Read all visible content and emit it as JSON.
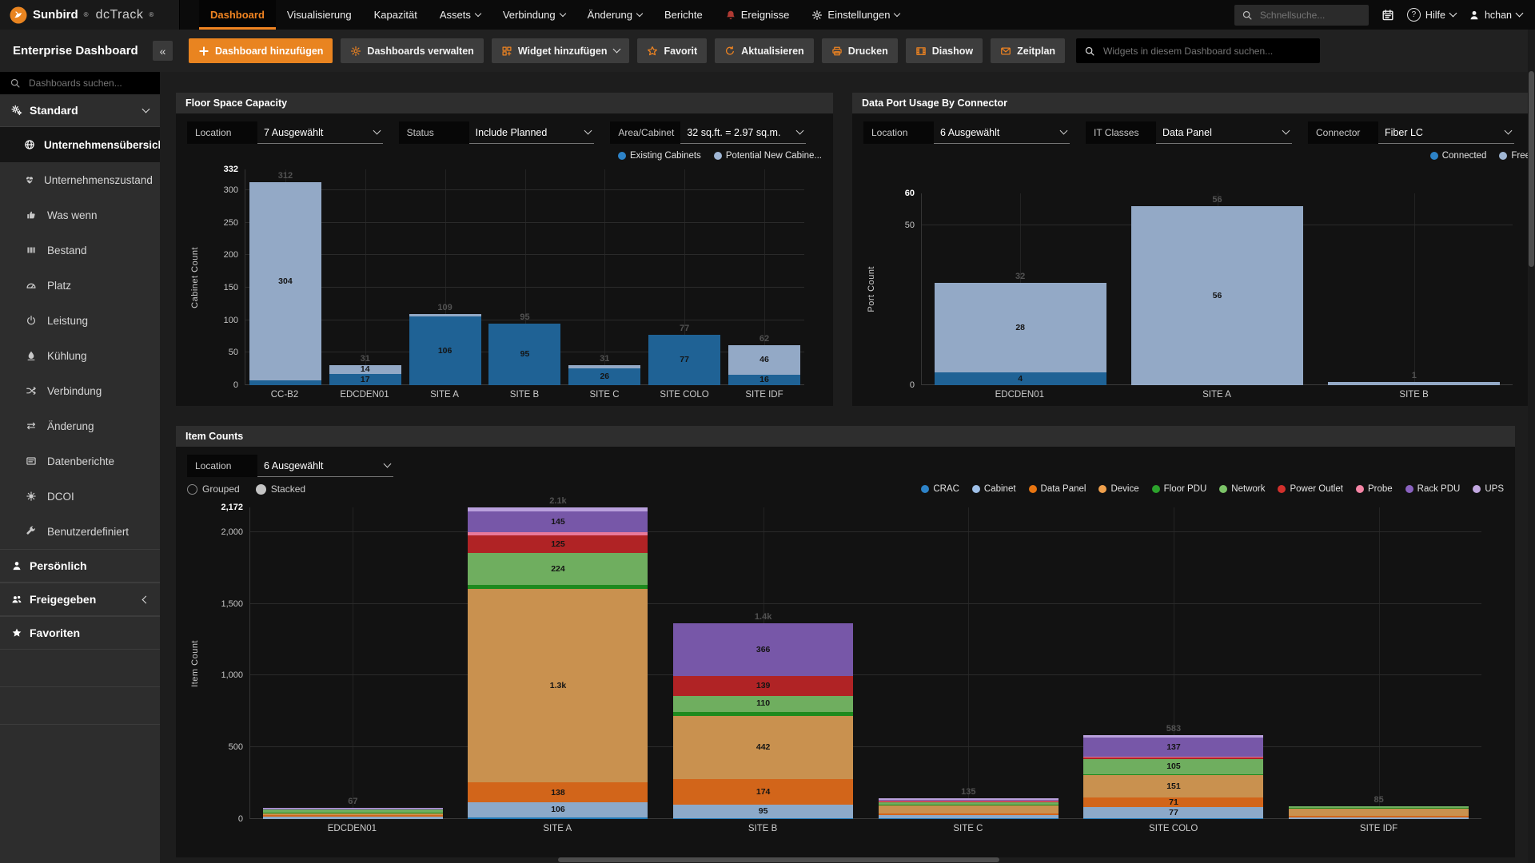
{
  "topnav": {
    "brand": {
      "name": "Sunbird",
      "product": "dcTrack",
      "reg": "®"
    },
    "items": [
      {
        "label": "Dashboard",
        "active": true
      },
      {
        "label": "Visualisierung"
      },
      {
        "label": "Kapazität"
      },
      {
        "label": "Assets",
        "caret": true
      },
      {
        "label": "Verbindung",
        "caret": true
      },
      {
        "label": "Änderung",
        "caret": true
      },
      {
        "label": "Berichte"
      },
      {
        "label": "Ereignisse",
        "icon": "bell"
      },
      {
        "label": "Einstellungen",
        "icon": "gear",
        "caret": true
      }
    ],
    "search_placeholder": "Schnellsuche...",
    "help_label": "Hilfe",
    "user_label": "hchan"
  },
  "toolbar": {
    "dashboard_title": "Enterprise Dashboard",
    "collapse_glyph": "«",
    "buttons": [
      {
        "label": "Dashboard hinzufügen",
        "icon": "plus",
        "primary": true
      },
      {
        "label": "Dashboards verwalten",
        "icon": "gear"
      },
      {
        "label": "Widget hinzufügen",
        "icon": "widget",
        "caret": true
      },
      {
        "label": "Favorit",
        "icon": "star"
      },
      {
        "label": "Aktualisieren",
        "icon": "refresh"
      },
      {
        "label": "Drucken",
        "icon": "printer"
      },
      {
        "label": "Diashow",
        "icon": "film"
      },
      {
        "label": "Zeitplan",
        "icon": "envelope"
      }
    ],
    "search_placeholder": "Widgets in diesem Dashboard suchen..."
  },
  "sidebar": {
    "search_placeholder": "Dashboards suchen...",
    "sections": [
      {
        "label": "Standard",
        "icon": "gears",
        "chevron": "down",
        "items": [
          {
            "label": "Unternehmensübersicht",
            "icon": "globe",
            "active": true
          },
          {
            "label": "Unternehmenszustand",
            "icon": "heartbeat"
          },
          {
            "label": "Was wenn",
            "icon": "thumb"
          },
          {
            "label": "Bestand",
            "icon": "bars"
          },
          {
            "label": "Platz",
            "icon": "gauge"
          },
          {
            "label": "Leistung",
            "icon": "power"
          },
          {
            "label": "Kühlung",
            "icon": "drop"
          },
          {
            "label": "Verbindung",
            "icon": "shuffle"
          },
          {
            "label": "Änderung",
            "icon": "swap"
          },
          {
            "label": "Datenberichte",
            "icon": "report"
          },
          {
            "label": "DCOI",
            "icon": "badge"
          },
          {
            "label": "Benutzerdefiniert",
            "icon": "wrench"
          }
        ]
      },
      {
        "label": "Persönlich",
        "icon": "person"
      },
      {
        "label": "Freigegeben",
        "icon": "people",
        "chevron": "left"
      },
      {
        "label": "Favoriten",
        "icon": "star-solid"
      }
    ]
  },
  "widgets": {
    "floor_space": {
      "title": "Floor Space Capacity",
      "filters": [
        {
          "label": "Location",
          "value": "7 Ausgewählt"
        },
        {
          "label": "Status",
          "value": "Include Planned"
        },
        {
          "label": "Area/Cabinet",
          "value": "32 sq.ft. = 2.97 sq.m."
        }
      ],
      "legend": [
        {
          "label": "Existing Cabinets",
          "color": "#2d83c8"
        },
        {
          "label": "Potential New Cabine...",
          "color": "#9fb6d4"
        }
      ]
    },
    "data_port": {
      "title": "Data Port Usage By Connector",
      "filters": [
        {
          "label": "Location",
          "value": "6 Ausgewählt"
        },
        {
          "label": "IT Classes",
          "value": "Data Panel"
        },
        {
          "label": "Connector",
          "value": "Fiber LC"
        }
      ],
      "legend": [
        {
          "label": "Connected",
          "color": "#2d83c8"
        },
        {
          "label": "Free",
          "color": "#9fb6d4"
        }
      ]
    },
    "item_counts": {
      "title": "Item Counts",
      "filters": [
        {
          "label": "Location",
          "value": "6 Ausgewählt"
        }
      ],
      "radios": [
        {
          "label": "Grouped",
          "selected": false
        },
        {
          "label": "Stacked",
          "selected": true
        }
      ],
      "legend": [
        {
          "label": "CRAC",
          "color": "#2d83c8"
        },
        {
          "label": "Cabinet",
          "color": "#9fc0e8"
        },
        {
          "label": "Data Panel",
          "color": "#e87511"
        },
        {
          "label": "Device",
          "color": "#f0a04c"
        },
        {
          "label": "Floor PDU",
          "color": "#2ca22c"
        },
        {
          "label": "Network",
          "color": "#7cc468"
        },
        {
          "label": "Power Outlet",
          "color": "#d2302c"
        },
        {
          "label": "Probe",
          "color": "#f585a5"
        },
        {
          "label": "Rack PDU",
          "color": "#8a62c0"
        },
        {
          "label": "UPS",
          "color": "#c2a8e0"
        }
      ]
    }
  },
  "chart_data": [
    {
      "id": "floor-space",
      "type": "bar",
      "title": "Floor Space Capacity",
      "ylabel": "Cabinet Count",
      "ymax": 332,
      "ticks": [
        {
          "v": 332,
          "label": "332",
          "bold": true
        },
        {
          "v": 300,
          "label": "300"
        },
        {
          "v": 250,
          "label": "250"
        },
        {
          "v": 200,
          "label": "200"
        },
        {
          "v": 150,
          "label": "150"
        },
        {
          "v": 100,
          "label": "100"
        },
        {
          "v": 50,
          "label": "50"
        },
        {
          "v": 0,
          "label": "0"
        }
      ],
      "categories": [
        "CC-B2",
        "EDCDEN01",
        "SITE A",
        "SITE B",
        "SITE C",
        "SITE COLO",
        "SITE IDF"
      ],
      "series": [
        {
          "name": "Existing Cabinets",
          "color": "#1f6295",
          "values": [
            8,
            17,
            106,
            95,
            26,
            77,
            16
          ],
          "labels": [
            "",
            "17",
            "106",
            "95",
            "26",
            "77",
            "16"
          ]
        },
        {
          "name": "Potential New Cabinets",
          "color": "#93a9c6",
          "values": [
            304,
            14,
            3,
            0,
            5,
            0,
            46
          ],
          "labels": [
            "304",
            "14",
            "",
            "",
            "",
            "",
            "46"
          ]
        }
      ],
      "totals": [
        "312",
        "31",
        "109",
        "95",
        "31",
        "77",
        "62"
      ]
    },
    {
      "id": "data-port",
      "type": "bar",
      "title": "Data Port Usage By Connector",
      "ylabel": "Port Count",
      "ymax": 60,
      "ticks": [
        {
          "v": 60,
          "label": "60",
          "bold": true
        },
        {
          "v": 50,
          "label": "50"
        },
        {
          "v": 0,
          "label": "0"
        }
      ],
      "categories": [
        "EDCDEN01",
        "SITE A",
        "SITE B"
      ],
      "series": [
        {
          "name": "Connected",
          "color": "#1f6295",
          "values": [
            4,
            0,
            0
          ],
          "labels": [
            "4",
            "",
            ""
          ]
        },
        {
          "name": "Free",
          "color": "#93a9c6",
          "values": [
            28,
            56,
            1
          ],
          "labels": [
            "28",
            "56",
            ""
          ]
        }
      ],
      "totals": [
        "32",
        "56",
        "1"
      ]
    },
    {
      "id": "item-counts",
      "type": "bar",
      "title": "Item Counts",
      "ylabel": "Item Count",
      "ymax": 2172,
      "ticks": [
        {
          "v": 2172,
          "label": "2,172",
          "bold": true
        },
        {
          "v": 2000,
          "label": "2,000"
        },
        {
          "v": 1500,
          "label": "1,500"
        },
        {
          "v": 1000,
          "label": "1,000"
        },
        {
          "v": 500,
          "label": "500"
        },
        {
          "v": 0,
          "label": "0"
        }
      ],
      "categories": [
        "EDCDEN01",
        "SITE A",
        "SITE B",
        "SITE C",
        "SITE COLO",
        "SITE IDF"
      ],
      "series": [
        {
          "name": "CRAC",
          "color": "#1f77b4",
          "values": [
            0,
            10,
            8,
            2,
            4,
            0
          ],
          "labels": [
            "",
            "",
            "",
            "",
            "",
            ""
          ]
        },
        {
          "name": "Cabinet",
          "color": "#8ca9c9",
          "values": [
            18,
            106,
            95,
            24,
            77,
            14
          ],
          "labels": [
            "",
            "106",
            "95",
            "",
            "77",
            ""
          ]
        },
        {
          "name": "Data Panel",
          "color": "#d2651a",
          "values": [
            10,
            138,
            174,
            10,
            71,
            6
          ],
          "labels": [
            "",
            "138",
            "174",
            "",
            "71",
            ""
          ]
        },
        {
          "name": "Device",
          "color": "#c9914f",
          "values": [
            14,
            1349,
            442,
            58,
            151,
            55
          ],
          "labels": [
            "",
            "1.3k",
            "442",
            "",
            "151",
            ""
          ]
        },
        {
          "name": "Floor PDU",
          "color": "#1e8a1e",
          "values": [
            3,
            28,
            30,
            4,
            10,
            2
          ],
          "labels": [
            "",
            "",
            "",
            "",
            "",
            ""
          ]
        },
        {
          "name": "Network",
          "color": "#6fae5f",
          "values": [
            18,
            224,
            110,
            12,
            105,
            8
          ],
          "labels": [
            "",
            "224",
            "110",
            "",
            "105",
            ""
          ]
        },
        {
          "name": "Power Outlet",
          "color": "#b02325",
          "values": [
            0,
            125,
            139,
            5,
            8,
            0
          ],
          "labels": [
            "",
            "125",
            "139",
            "",
            "",
            ""
          ]
        },
        {
          "name": "Probe",
          "color": "#e8799b",
          "values": [
            0,
            20,
            0,
            4,
            6,
            0
          ],
          "labels": [
            "",
            "",
            "",
            "",
            "",
            ""
          ]
        },
        {
          "name": "Rack PDU",
          "color": "#7757a8",
          "values": [
            2,
            145,
            366,
            10,
            137,
            0
          ],
          "labels": [
            "",
            "145",
            "366",
            "",
            "137",
            ""
          ]
        },
        {
          "name": "UPS",
          "color": "#b9a0dc",
          "values": [
            2,
            27,
            0,
            6,
            14,
            0
          ],
          "labels": [
            "",
            "",
            "",
            "",
            "",
            ""
          ]
        }
      ],
      "totals": [
        "67",
        "2.1k",
        "1.4k",
        "135",
        "583",
        "85"
      ]
    }
  ]
}
